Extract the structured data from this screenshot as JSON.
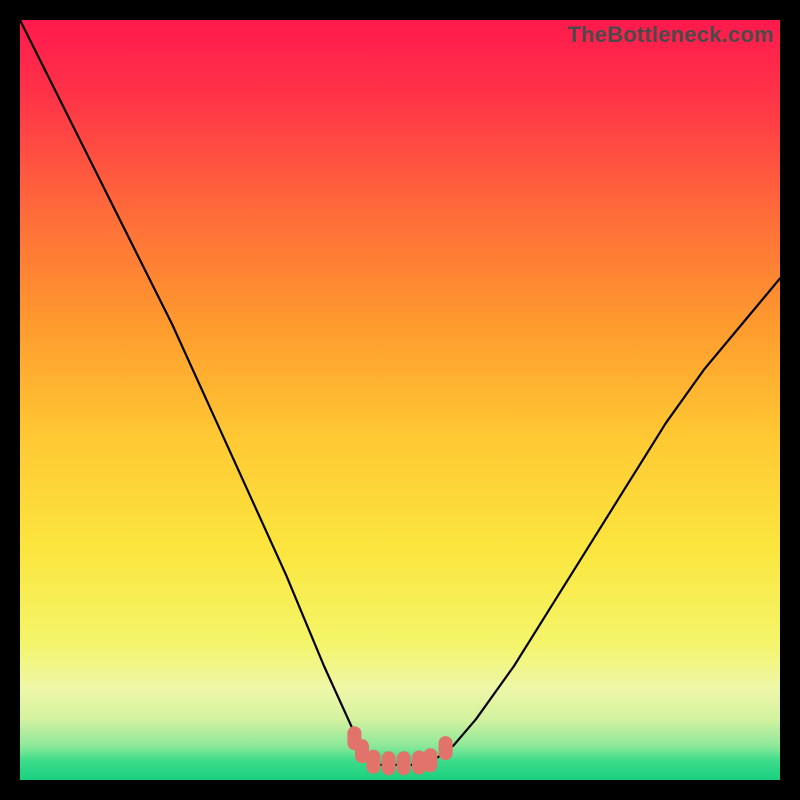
{
  "watermark": "TheBottleneck.com",
  "chart_data": {
    "type": "line",
    "title": "",
    "xlabel": "",
    "ylabel": "",
    "xlim": [
      0,
      100
    ],
    "ylim": [
      0,
      100
    ],
    "series": [
      {
        "name": "bottleneck-curve",
        "x": [
          0,
          5,
          10,
          15,
          20,
          25,
          30,
          35,
          40,
          45,
          46,
          47,
          48,
          50,
          52,
          54,
          55,
          57,
          60,
          65,
          70,
          75,
          80,
          85,
          90,
          95,
          100
        ],
        "values": [
          100,
          90,
          80,
          70,
          60,
          49,
          38,
          27,
          15,
          4,
          2.5,
          2,
          2,
          2,
          2,
          2.5,
          3,
          4.5,
          8,
          15,
          23,
          31,
          39,
          47,
          54,
          60,
          66
        ]
      }
    ],
    "markers": [
      {
        "name": "left-thumb",
        "x": 44.0,
        "y": 5.5
      },
      {
        "name": "left-thumb-2",
        "x": 45.0,
        "y": 3.8
      },
      {
        "name": "flat-1",
        "x": 46.5,
        "y": 2.4
      },
      {
        "name": "flat-2",
        "x": 48.5,
        "y": 2.2
      },
      {
        "name": "flat-3",
        "x": 50.5,
        "y": 2.2
      },
      {
        "name": "flat-4",
        "x": 52.5,
        "y": 2.3
      },
      {
        "name": "flat-5",
        "x": 54.0,
        "y": 2.6
      },
      {
        "name": "right-thumb",
        "x": 56.0,
        "y": 4.2
      }
    ],
    "gradient_stops": [
      {
        "offset": 0.0,
        "color": "#ff1a4d"
      },
      {
        "offset": 0.1,
        "color": "#ff3348"
      },
      {
        "offset": 0.25,
        "color": "#ff6a3a"
      },
      {
        "offset": 0.4,
        "color": "#ff9a2e"
      },
      {
        "offset": 0.55,
        "color": "#ffc933"
      },
      {
        "offset": 0.7,
        "color": "#fbe63f"
      },
      {
        "offset": 0.82,
        "color": "#f4f56a"
      },
      {
        "offset": 0.88,
        "color": "#eef7a8"
      },
      {
        "offset": 0.92,
        "color": "#d4f2a0"
      },
      {
        "offset": 0.955,
        "color": "#8de89a"
      },
      {
        "offset": 0.975,
        "color": "#3cdc8a"
      },
      {
        "offset": 1.0,
        "color": "#19d07e"
      }
    ],
    "marker_color": "#e2736b"
  }
}
